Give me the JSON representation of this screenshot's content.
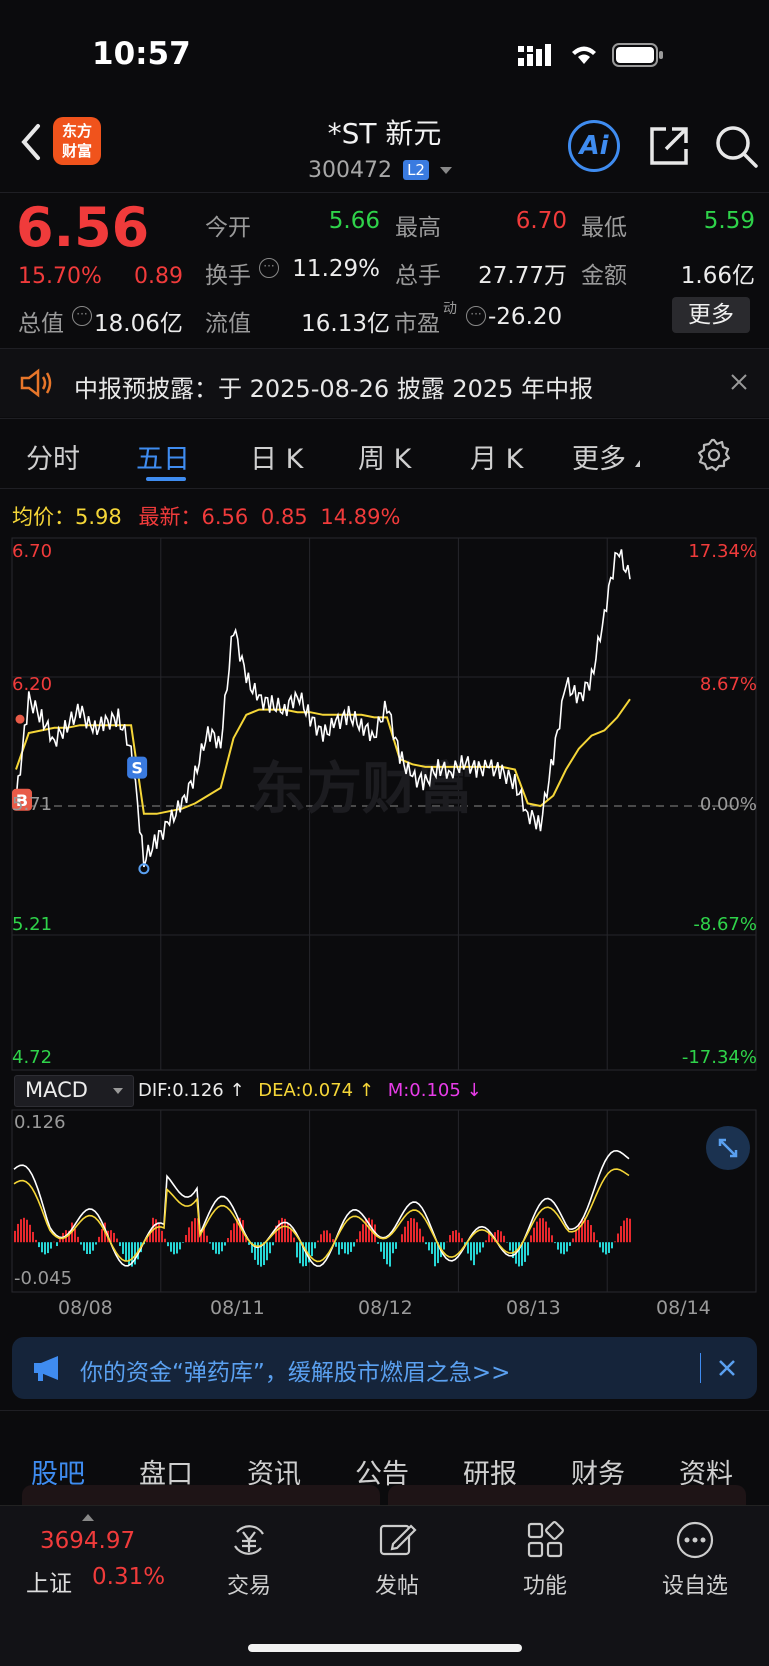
{
  "status_bar": {
    "time": "10:57"
  },
  "header": {
    "back_icon": "chevron-left-icon",
    "logo_text_1": "东方",
    "logo_text_2": "财富",
    "title": "*ST 新元",
    "code": "300472",
    "level_badge": "L2",
    "ai_label": "Ai"
  },
  "quote": {
    "price": "6.56",
    "change_pct": "15.70%",
    "change": "0.89",
    "rows": [
      [
        {
          "label": "今开",
          "value": "5.66",
          "color": "green"
        },
        {
          "label": "最高",
          "value": "6.70",
          "color": "red"
        },
        {
          "label": "最低",
          "value": "5.59",
          "color": "green"
        }
      ],
      [
        {
          "label": "换手",
          "value": "11.29%",
          "color": "white"
        },
        {
          "label": "总手",
          "value": "27.77万",
          "color": "white"
        },
        {
          "label": "金额",
          "value": "1.66亿",
          "color": "white"
        }
      ]
    ],
    "row3": {
      "label1": "总值",
      "value1": "18.06亿",
      "label2": "流值",
      "value2": "16.13亿",
      "label3": "市盈",
      "sup3": "动",
      "value3": "-26.20"
    },
    "more_button": "更多"
  },
  "notice": {
    "text": "中报预披露：于 2025-08-26 披露 2025 年中报"
  },
  "tabs": [
    {
      "label": "分时",
      "active": false
    },
    {
      "label": "五日",
      "active": true
    },
    {
      "label": "日 K",
      "active": false
    },
    {
      "label": "周 K",
      "active": false
    },
    {
      "label": "月 K",
      "active": false
    },
    {
      "label": "更多",
      "active": false
    }
  ],
  "chart_info": {
    "avg_label": "均价：",
    "avg_value": "5.98",
    "latest_label": "最新：",
    "latest_price": "6.56",
    "latest_change": "0.85",
    "latest_pct": "14.89%"
  },
  "chart_data": {
    "type": "line",
    "price_axis": {
      "labels_left": [
        "6.70",
        "6.20",
        "5.71",
        "5.21",
        "4.72"
      ],
      "labels_right": [
        "17.34%",
        "8.67%",
        "0.00%",
        "-8.67%",
        "-17.34%"
      ],
      "ylim": [
        4.72,
        6.7
      ]
    },
    "x_labels": [
      "08/08",
      "08/11",
      "08/12",
      "08/13",
      "08/14"
    ],
    "series": [
      {
        "name": "price",
        "color": "#ffffff",
        "values": [
          5.73,
          6.12,
          6.05,
          5.96,
          6.02,
          6.08,
          6.0,
          6.03,
          6.05,
          5.93,
          5.5,
          5.58,
          5.65,
          5.72,
          5.83,
          6.0,
          5.95,
          6.4,
          6.2,
          6.12,
          6.1,
          6.08,
          6.14,
          6.05,
          5.98,
          6.03,
          6.06,
          6.02,
          5.98,
          6.1,
          5.9,
          5.82,
          5.8,
          5.86,
          5.84,
          5.88,
          5.85,
          5.86,
          5.84,
          5.8,
          5.68,
          5.64,
          5.9,
          6.18,
          6.12,
          6.2,
          6.45,
          6.7,
          6.58
        ]
      },
      {
        "name": "avg",
        "color": "#f5d638",
        "values": [
          5.85,
          5.99,
          6.0,
          6.01,
          6.01,
          6.02,
          6.02,
          6.02,
          6.02,
          6.02,
          5.68,
          5.68,
          5.69,
          5.7,
          5.72,
          5.75,
          5.78,
          5.97,
          6.06,
          6.08,
          6.08,
          6.08,
          6.07,
          6.07,
          6.06,
          6.06,
          6.06,
          6.06,
          6.05,
          6.05,
          5.89,
          5.87,
          5.86,
          5.86,
          5.86,
          5.86,
          5.86,
          5.86,
          5.86,
          5.85,
          5.72,
          5.71,
          5.75,
          5.85,
          5.93,
          5.98,
          6.0,
          6.05,
          6.12
        ]
      }
    ],
    "markers": [
      {
        "label": "S"
      },
      {
        "label": "B"
      }
    ],
    "macd": {
      "indicator": "MACD",
      "dif_label": "DIF:",
      "dif": "0.126",
      "dif_arrow": "↑",
      "dea_label": "DEA:",
      "dea": "0.074",
      "dea_arrow": "↑",
      "m_label": "M:",
      "m": "0.105",
      "m_arrow": "↓",
      "ymax_label": "0.126",
      "ymin_label": "-0.045",
      "ylim": [
        -0.045,
        0.126
      ]
    }
  },
  "ad_banner": {
    "text": "你的资金“弹药库”，缓解股市燃眉之急>>"
  },
  "sub_tabs": [
    {
      "label": "股吧",
      "active": true
    },
    {
      "label": "盘口",
      "active": false
    },
    {
      "label": "资讯",
      "active": false
    },
    {
      "label": "公告",
      "active": false
    },
    {
      "label": "研报",
      "active": false
    },
    {
      "label": "财务",
      "active": false
    },
    {
      "label": "资料",
      "active": false
    }
  ],
  "bottom_bar": {
    "index_value": "3694.97",
    "index_name": "上证",
    "index_pct": "0.31%",
    "tools": [
      {
        "label": "交易",
        "icon": "yen-exchange-icon"
      },
      {
        "label": "发帖",
        "icon": "edit-post-icon"
      },
      {
        "label": "功能",
        "icon": "grid-apps-icon"
      },
      {
        "label": "设自选",
        "icon": "more-dots-icon"
      }
    ]
  },
  "colors": {
    "up": "#f03b3b",
    "down": "#2fd34a",
    "accent": "#3f8cf0",
    "avg": "#f5d638",
    "dif": "#f5d638",
    "macd_m": "#e83ce8"
  }
}
